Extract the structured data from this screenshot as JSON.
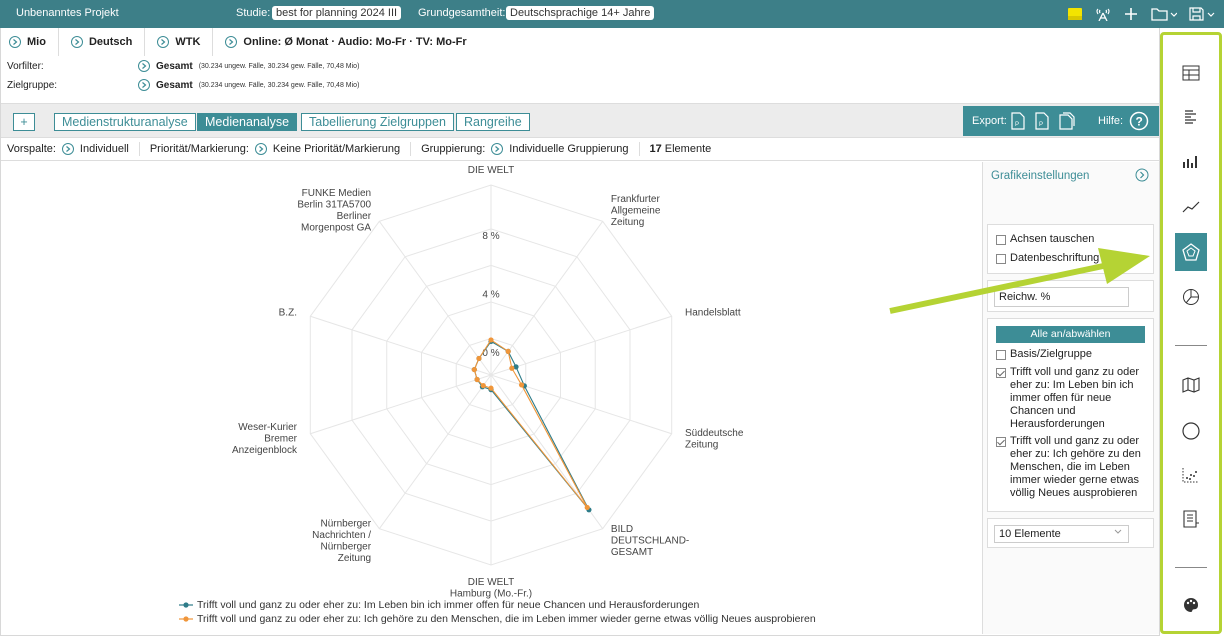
{
  "topbar": {
    "project": "Unbenanntes Projekt",
    "study_label": "Studie:",
    "study_value": "best for planning 2024 III",
    "pop_label": "Grundgesamtheit:",
    "pop_value": "Deutschsprachige 14+ Jahre",
    "icons": [
      "note-icon",
      "broadcast-icon",
      "plus-icon",
      "folder-icon",
      "save-icon"
    ]
  },
  "row1": {
    "items": [
      "Mio",
      "Deutsch",
      "WTK",
      "Online: Ø Monat · Audio: Mo-Fr · TV: Mo-Fr"
    ]
  },
  "filters": {
    "vorfilter_label": "Vorfilter:",
    "vorfilter_value": "Gesamt",
    "vorfilter_detail": "(30.234 ungew. Fälle, 30.234 gew. Fälle, 70,48 Mio)",
    "zielgruppe_label": "Zielgruppe:",
    "zielgruppe_value": "Gesamt",
    "zielgruppe_detail": "(30.234 ungew. Fälle, 30.234 gew. Fälle, 70,48 Mio)"
  },
  "toolbar": {
    "plus": "+",
    "tabs": [
      "Medienstrukturanalyse",
      "Medienanalyse",
      "Tabellierung Zielgruppen",
      "Rangreihe"
    ],
    "active_tab": "Medienanalyse",
    "export_label": "Export:",
    "help_label": "Hilfe:"
  },
  "row3": {
    "vorspalte_label": "Vorspalte:",
    "vorspalte_value": "Individuell",
    "prio_label": "Priorität/Markierung:",
    "prio_value": "Keine Priorität/Markierung",
    "grp_label": "Gruppierung:",
    "grp_value": "Individuelle Gruppierung",
    "elements_count": "17",
    "elements_label": "Elemente"
  },
  "settings": {
    "title": "Grafikeinstellungen",
    "axes_swap": "Achsen tauschen",
    "data_labels": "Datenbeschriftung",
    "measure": "Reichw. %",
    "toggle_all": "Alle an/abwählen",
    "series_options": [
      {
        "label": "Basis/Zielgruppe",
        "checked": false
      },
      {
        "label": "Trifft voll und ganz zu oder eher zu: Im Leben bin ich immer offen für neue Chancen und Herausforderungen",
        "checked": true
      },
      {
        "label": "Trifft voll und ganz zu oder eher zu: Ich gehöre zu den Menschen, die im Leben immer wieder gerne etwas völlig Neues ausprobieren",
        "checked": true
      }
    ],
    "elements_select": "10 Elemente"
  },
  "sidebar": {
    "icons": [
      "table-icon",
      "text-list-icon",
      "bar-chart-icon",
      "line-chart-icon",
      "radar-chart-icon",
      "pie-chart-icon",
      "map-icon",
      "circle-icon",
      "scatter-icon",
      "report-icon",
      "palette-icon"
    ],
    "active": "radar-chart-icon"
  },
  "colors": {
    "teal": "#3d8d96",
    "topbar": "#3d7f88",
    "series1": "#2e7c89",
    "series2": "#f0963a",
    "highlight": "#b5d334"
  },
  "chart_data": {
    "type": "radar",
    "categories": [
      "DIE WELT",
      "Frankfurter Allgemeine Zeitung",
      "Handelsblatt",
      "Süddeutsche Zeitung",
      "BILD DEUTSCHLAND-GESAMT",
      "DIE WELT Hamburg (Mo.-Fr.)",
      "Nürnberger Nachrichten / Nürnberger Zeitung",
      "Weser-Kurier Bremer Anzeigenblock",
      "B.Z.",
      "FUNKE Medien Berlin 31TA5700 Berliner Morgenpost GA"
    ],
    "ticks": [
      "0 %",
      "4 %",
      "8 %"
    ],
    "rlim": [
      -1.5,
      11.5
    ],
    "series": [
      {
        "name": "Trifft voll und ganz zu oder eher zu: Im Leben bin ich immer offen für neue Chancen und Herausforderungen",
        "values": [
          0.8,
          0.5,
          0.3,
          0.9,
          9.9,
          -0.5,
          -0.5,
          -0.5,
          -0.3,
          -0.1
        ]
      },
      {
        "name": "Trifft voll und ganz zu oder eher zu: Ich gehöre zu den Menschen, die im Leben immer wieder gerne etwas völlig Neues ausprobieren",
        "values": [
          0.9,
          0.5,
          0.0,
          0.7,
          9.7,
          -0.6,
          -0.6,
          -0.5,
          -0.3,
          -0.1
        ]
      }
    ],
    "legend_position": "bottom"
  }
}
